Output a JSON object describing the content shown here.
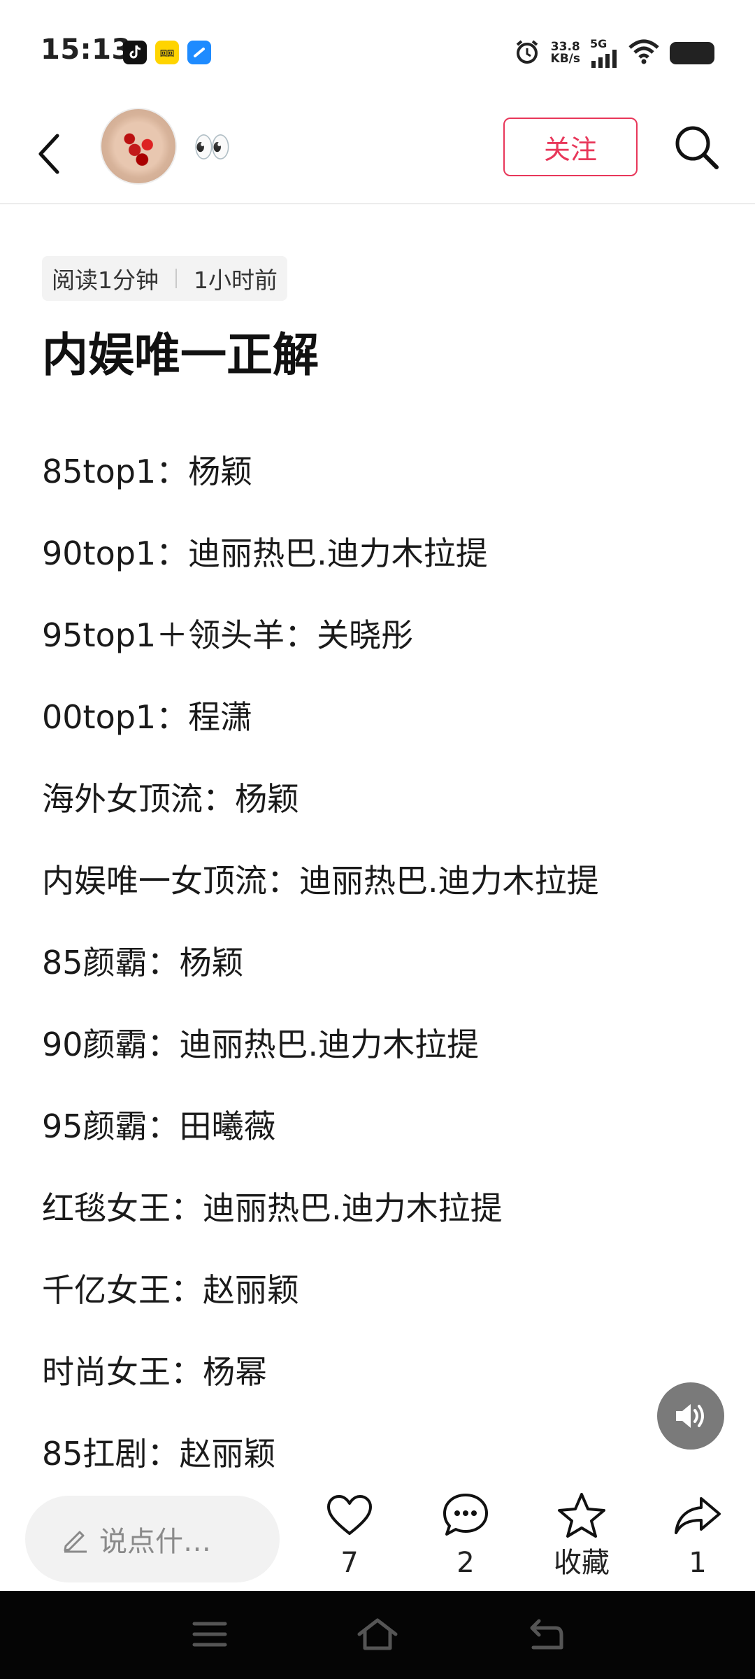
{
  "status_bar": {
    "time": "15:13",
    "net_speed_value": "33.8",
    "net_speed_unit": "KB/s",
    "network": "5G",
    "app_icons": [
      "douyin-icon",
      "yellow-app-icon",
      "blue-app-icon"
    ],
    "yellow_app_label": "回回"
  },
  "header": {
    "user_name": "👀",
    "follow_label": "关注"
  },
  "article": {
    "read_time": "阅读1分钟",
    "posted": "1小时前",
    "title": "内娱唯一正解",
    "lines": [
      "85top1：杨颖",
      "90top1：迪丽热巴.迪力木拉提",
      "95top1＋领头羊：关晓彤",
      "00top1：程潇",
      "海外女顶流：杨颖",
      "内娱唯一女顶流：迪丽热巴.迪力木拉提",
      "85颜霸：杨颖",
      "90颜霸：迪丽热巴.迪力木拉提",
      "95颜霸：田曦薇",
      "红毯女王：迪丽热巴.迪力木拉提",
      "千亿女王：赵丽颖",
      "时尚女王：杨幂",
      "85扛剧：赵丽颖"
    ]
  },
  "action_bar": {
    "comment_placeholder": "说点什…",
    "like_count": "7",
    "comment_count": "2",
    "favorite_label": "收藏",
    "share_count": "1"
  },
  "colors": {
    "accent": "#e8375a",
    "nav_bar": "#050505"
  }
}
